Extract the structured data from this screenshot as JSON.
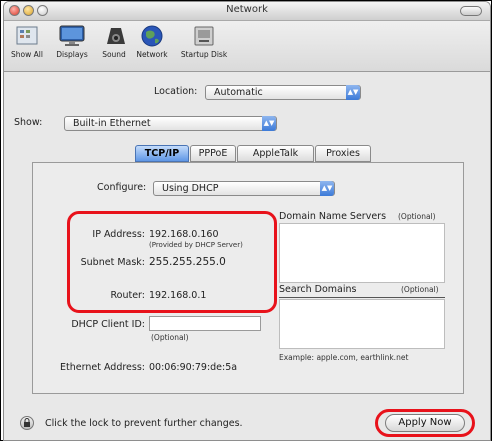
{
  "window": {
    "title": "Network"
  },
  "toolbar": {
    "items": [
      {
        "label": "Show All",
        "icon": "show-all-icon"
      },
      {
        "label": "Displays",
        "icon": "display-icon"
      },
      {
        "label": "Sound",
        "icon": "speaker-icon"
      },
      {
        "label": "Network",
        "icon": "globe-icon"
      },
      {
        "label": "Startup Disk",
        "icon": "disk-icon"
      }
    ]
  },
  "location": {
    "label": "Location:",
    "value": "Automatic"
  },
  "show": {
    "label": "Show:",
    "value": "Built-in Ethernet"
  },
  "tabs": [
    "TCP/IP",
    "PPPoE",
    "AppleTalk",
    "Proxies"
  ],
  "configure": {
    "label": "Configure:",
    "value": "Using DHCP"
  },
  "tcpip": {
    "ip_label": "IP Address:",
    "ip_value": "192.168.0.160",
    "ip_note": "(Provided by DHCP Server)",
    "subnet_label": "Subnet Mask:",
    "subnet_value": "255.255.255.0",
    "router_label": "Router:",
    "router_value": "192.168.0.1",
    "dhcp_label": "DHCP Client ID:",
    "dhcp_note": "(Optional)",
    "ethernet_label": "Ethernet Address:",
    "ethernet_value": "00:06:90:79:de:5a",
    "dns_label": "Domain Name Servers",
    "dns_note": "(Optional)",
    "search_label": "Search Domains",
    "search_note": "(Optional)",
    "example": "Example: apple.com, earthlink.net"
  },
  "footer": {
    "lock_text": "Click the lock to prevent further changes.",
    "apply_label": "Apply Now"
  },
  "colors": {
    "highlight": "#e8121b",
    "selected_tab": "#5f97e6"
  }
}
